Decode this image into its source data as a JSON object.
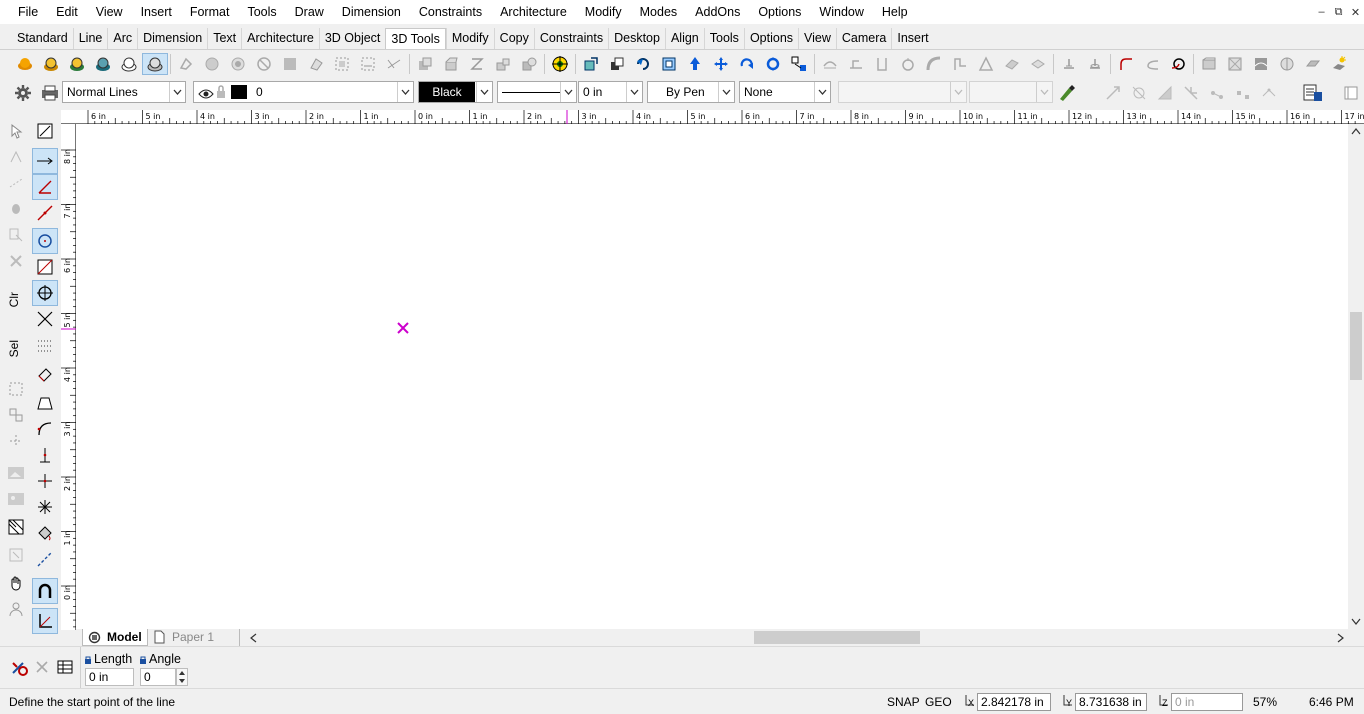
{
  "menu": [
    "File",
    "Edit",
    "View",
    "Insert",
    "Format",
    "Tools",
    "Draw",
    "Dimension",
    "Constraints",
    "Architecture",
    "Modify",
    "Modes",
    "AddOns",
    "Options",
    "Window",
    "Help"
  ],
  "tabs": [
    "Standard",
    "Line",
    "Arc",
    "Dimension",
    "Text",
    "Architecture",
    "3D Object",
    "3D Tools",
    "Modify",
    "Copy",
    "Constraints",
    "Desktop",
    "Align",
    "Tools",
    "Options",
    "View",
    "Camera",
    "Insert"
  ],
  "active_tab": "3D Tools",
  "properties": {
    "line_style": "Normal Lines",
    "layer": "0",
    "color": "Black",
    "line_width": "0 in",
    "pen": "By Pen",
    "fill": "None"
  },
  "ruler": {
    "h_labels": [
      "6 in",
      "5 in",
      "4 in",
      "3 in",
      "2 in",
      "1 in",
      "0 in",
      "1 in",
      "2 in",
      "3 in",
      "4 in",
      "5 in",
      "6 in",
      "7 in",
      "8 in",
      "9 in",
      "10 in",
      "11 in",
      "12 in",
      "13 in",
      "14 in",
      "15 in",
      "16 in",
      "17 in"
    ],
    "v_labels": [
      "8 in",
      "7 in",
      "6 in",
      "5 in",
      "4 in",
      "3 in",
      "2 in",
      "1 in",
      "0 in"
    ]
  },
  "left_labels": {
    "clr": "Clr",
    "sel": "Sel"
  },
  "sheet_tabs": {
    "model": "Model",
    "paper": "Paper 1"
  },
  "inputs": {
    "length_label": "Length",
    "length_value": "0 in",
    "angle_label": "Angle",
    "angle_value": "0"
  },
  "status": {
    "message": "Define the start point of the line",
    "snap": "SNAP",
    "geo": "GEO",
    "x_label": "X",
    "x_value": "2.842178 in",
    "y_label": "Y",
    "y_value": "8.731638 in",
    "z_label": "Z",
    "z_placeholder": "0 in",
    "zoom": "57%",
    "time": "6:46 PM"
  },
  "colors": {
    "accent": "#cce4f7",
    "cursor": "#cc00cc",
    "swatch": "#000000"
  }
}
